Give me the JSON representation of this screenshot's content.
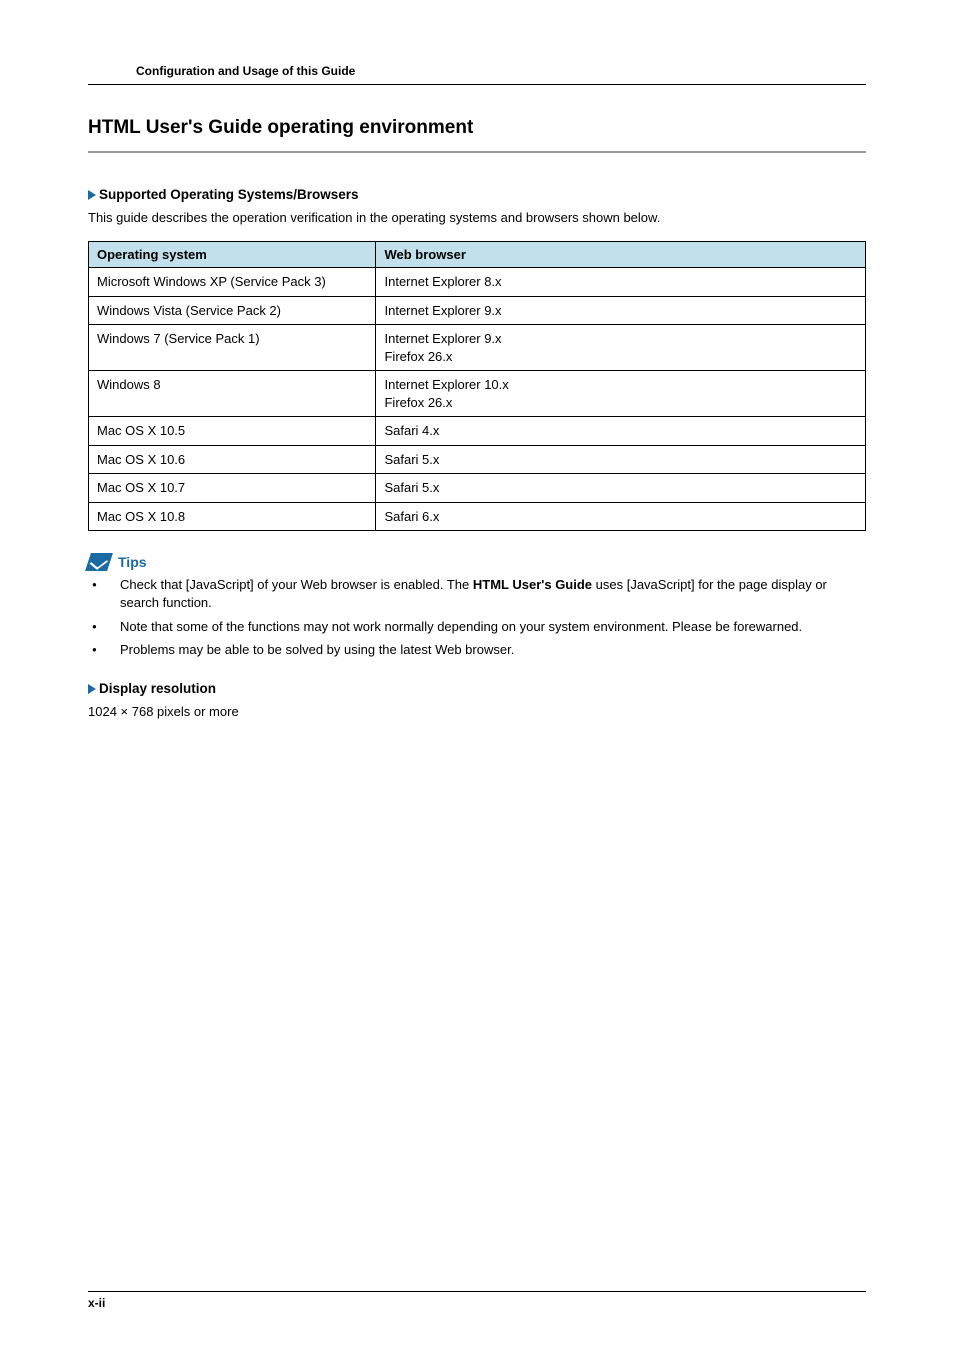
{
  "header": {
    "breadcrumb": "Configuration and Usage of this Guide"
  },
  "title": "HTML User's Guide operating environment",
  "sections": {
    "supported": {
      "heading": "Supported Operating Systems/Browsers",
      "intro": "This guide describes the operation verification in the operating systems and browsers shown below."
    },
    "display_resolution": {
      "heading": "Display resolution",
      "value": "1024 × 768 pixels or more"
    }
  },
  "table": {
    "headers": {
      "os": "Operating system",
      "browser": "Web browser"
    },
    "rows": [
      {
        "os": "Microsoft Windows XP (Service Pack 3)",
        "browser": "Internet Explorer 8.x"
      },
      {
        "os": "Windows Vista (Service Pack 2)",
        "browser": "Internet Explorer 9.x"
      },
      {
        "os": "Windows 7 (Service Pack 1)",
        "browser": "Internet Explorer 9.x\nFirefox 26.x"
      },
      {
        "os": "Windows 8",
        "browser": "Internet Explorer 10.x\nFirefox 26.x"
      },
      {
        "os": "Mac OS X 10.5",
        "browser": "Safari 4.x"
      },
      {
        "os": "Mac OS X 10.6",
        "browser": "Safari 5.x"
      },
      {
        "os": "Mac OS X 10.7",
        "browser": "Safari 5.x"
      },
      {
        "os": "Mac OS X 10.8",
        "browser": "Safari 6.x"
      }
    ]
  },
  "tips": {
    "label": "Tips",
    "items": [
      {
        "pre": "Check that [JavaScript] of your Web browser is enabled. The ",
        "bold": "HTML User's Guide",
        "post": " uses [JavaScript] for the page display or search function."
      },
      {
        "pre": "Note that some of the functions may not work normally depending on your system environment. Please be forewarned.",
        "bold": "",
        "post": ""
      },
      {
        "pre": "Problems may be able to be solved by using the latest Web browser.",
        "bold": "",
        "post": ""
      }
    ]
  },
  "footer": {
    "page_number": "x-ii"
  }
}
